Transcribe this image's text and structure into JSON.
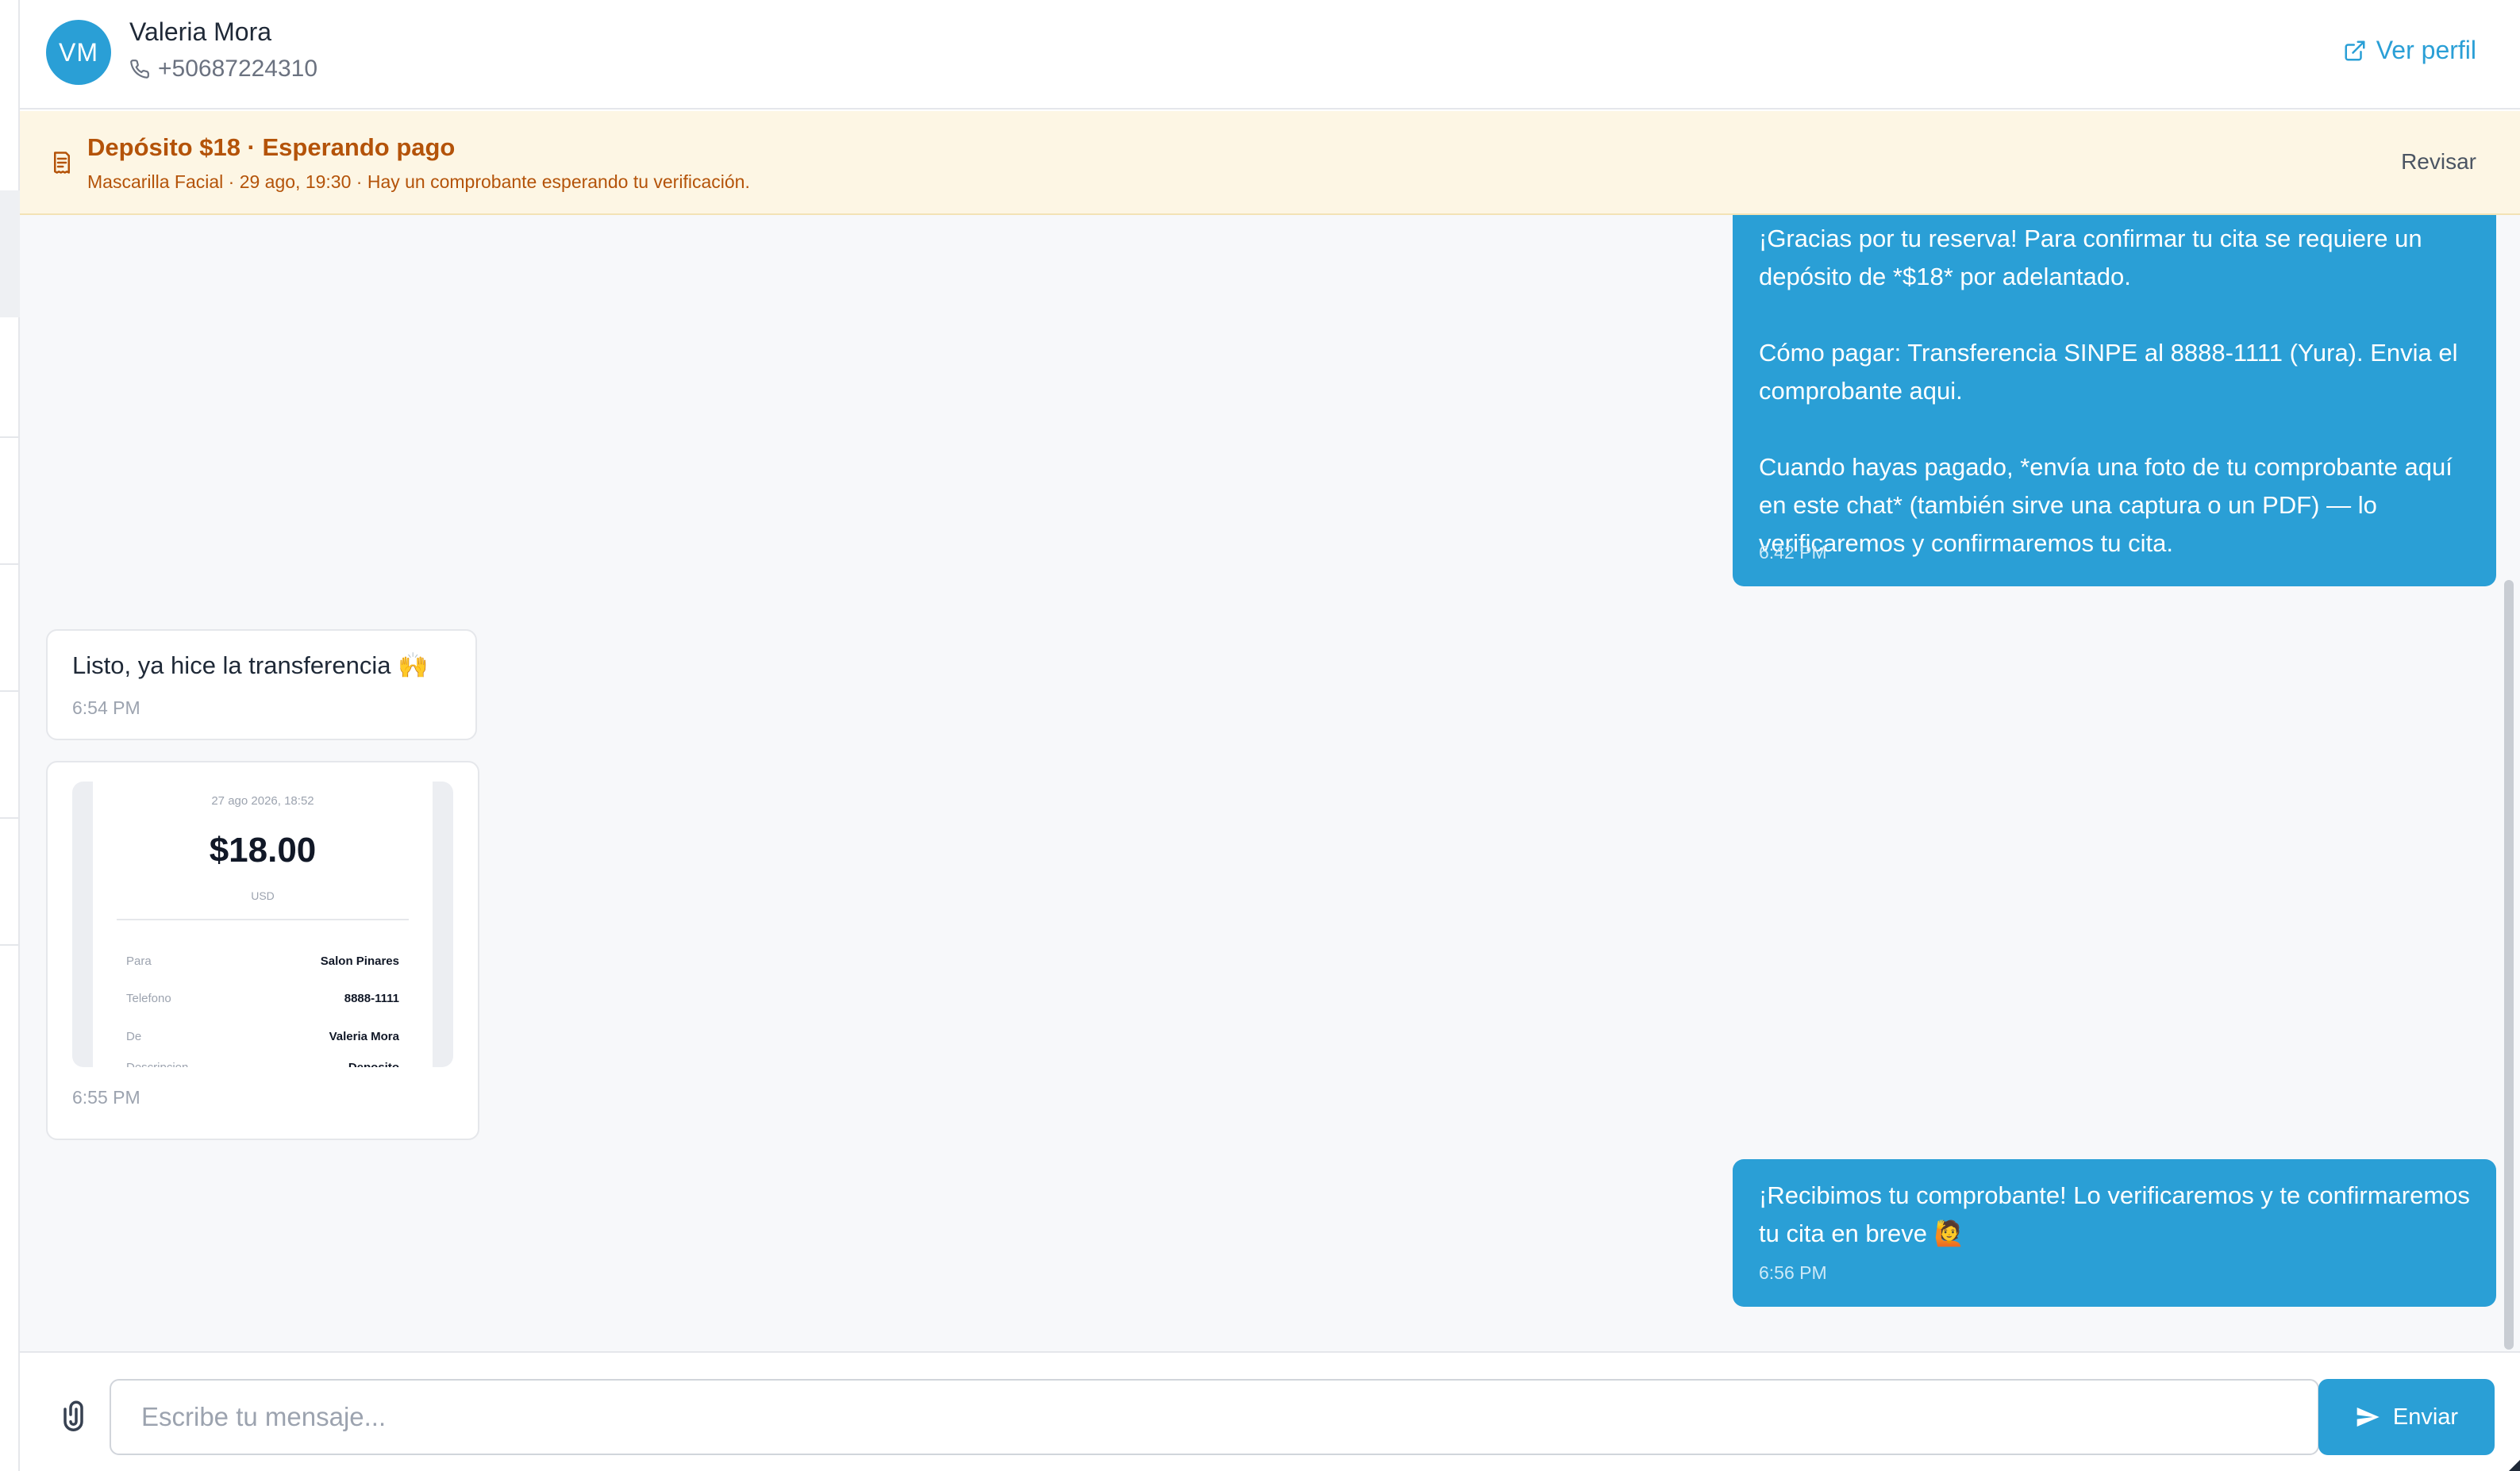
{
  "contact": {
    "initials": "VM",
    "name": "Valeria Mora",
    "phone": "+50687224310",
    "profile_link": "Ver perfil"
  },
  "banner": {
    "title": "Depósito $18 · Esperando pago",
    "subtitle": "Mascarilla Facial · 29 ago, 19:30 · Hay un comprobante esperando tu verificación.",
    "action": "Revisar",
    "accent_color": "#b45309",
    "background_color": "#fdf6e4"
  },
  "messages": [
    {
      "direction": "outgoing",
      "text": "¡Gracias por tu reserva! Para confirmar tu cita se requiere un depósito de *$18* por adelantado.\n\nCómo pagar: Transferencia SINPE al 8888-1111 (Yura). Envia el comprobante aqui.\n\nCuando hayas pagado, *envía una foto de tu comprobante aquí en este chat* (también sirve una captura o un PDF) — lo verificaremos y confirmaremos tu cita.",
      "time": "6:42 PM"
    },
    {
      "direction": "incoming",
      "text": "Listo, ya hice la transferencia 🙌",
      "time": "6:54 PM"
    },
    {
      "direction": "incoming",
      "type": "image",
      "time": "6:55 PM",
      "receipt": {
        "date": "27 ago 2026, 18:52",
        "amount": "$18.00",
        "currency": "USD",
        "rows": [
          {
            "label": "Para",
            "value": "Salon Pinares"
          },
          {
            "label": "Telefono",
            "value": "8888-1111"
          },
          {
            "label": "De",
            "value": "Valeria Mora"
          },
          {
            "label": "Descripcion",
            "value": "Deposito"
          }
        ]
      }
    },
    {
      "direction": "outgoing",
      "text": "¡Recibimos tu comprobante! Lo verificaremos y te confirmaremos tu cita en breve 🙋",
      "time": "6:56 PM"
    }
  ],
  "composer": {
    "placeholder": "Escribe tu mensaje...",
    "send_label": "Enviar"
  },
  "colors": {
    "accent": "#2a9fd6",
    "chat_background": "#f7f8fa"
  }
}
